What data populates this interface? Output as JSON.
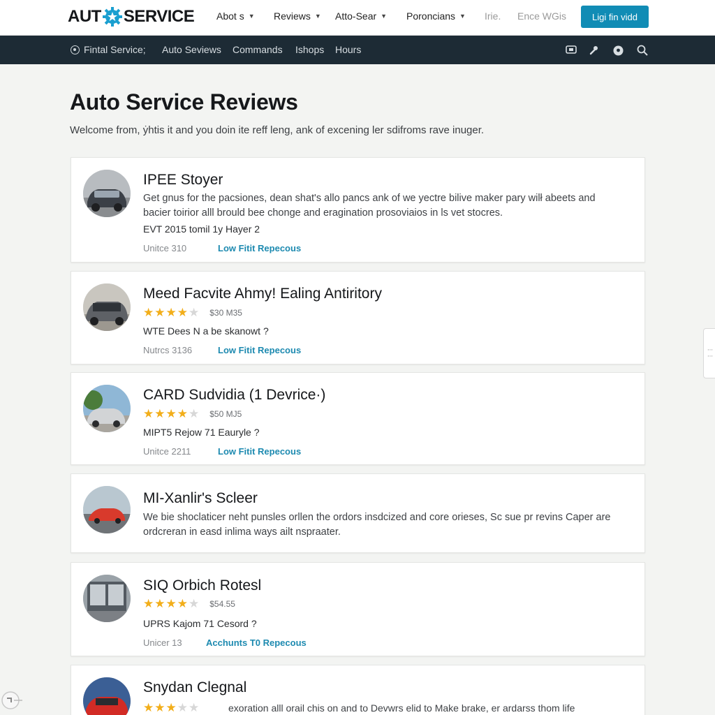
{
  "header": {
    "logo_left": "AUT",
    "logo_right": "SERVICE",
    "nav": [
      {
        "label": "Abot s",
        "has_menu": true
      },
      {
        "label": "Reviews",
        "has_menu": true
      },
      {
        "label": "Atto-Sear",
        "has_menu": true
      },
      {
        "label": "Poroncians",
        "has_menu": true
      },
      {
        "label": "Irie.",
        "has_menu": false
      },
      {
        "label": "Ence WGis",
        "has_menu": false
      }
    ],
    "login_label": "Ligi fin vidd",
    "accent_color": "#118cb5"
  },
  "subnav": {
    "items": [
      "Fintal Service;",
      "Auto Seviews",
      "Commands",
      "Ishops",
      "Hours"
    ],
    "icons": [
      "message-icon",
      "wrench-icon",
      "profile-icon",
      "search-icon"
    ]
  },
  "page": {
    "title": "Auto Service Reviews",
    "intro": "Welcome from, ẏhtis it and you doin ite reff leng, ank of excening ler sdifroms rave inuger."
  },
  "reviews": [
    {
      "title": "IPEE Stoyer",
      "description": "Get gnus for the pacsiones, dean shat's allo pancs ank of we yectre bilive maker pary wilł abeets and bacier toirior alll brould bee chonge and eragination prosoviaios in ls vet stocres.",
      "detail": "EVT 2015 tomil 1y Hayer 2",
      "meta": "Unitce 310",
      "link": "Low Fitit Repecous"
    },
    {
      "title": "Meed Facvite Ahmy! Ealing Antiritory",
      "rating": 4,
      "price": "$30 M35",
      "detail": "WTE Dees N a be skanowt ?",
      "meta": "Nutrcs 3136",
      "link": "Low Fitit Repecous"
    },
    {
      "title": "CARD Sudvidia (1 Devrice·)",
      "rating": 4,
      "price": "$50 MJ5",
      "detail": "MIPT5 Rejow 71 Eauryle ?",
      "meta": "Unitce 2211",
      "link": "Low Fitit Repecous"
    },
    {
      "title": "MI-Xanlir's Scleer",
      "description": "We bie shoclaticer neht punsles orllen the ordors insdcized and core orieses, Sc sue pr revins Caper are ordcreran in easd inlima ways ailt nspraater."
    },
    {
      "title": "SIQ Orbich Rotesl",
      "rating": 4,
      "price": "$54.55",
      "detail": "UPRS Kajom 71 Cesord ?",
      "meta": "Unicer 13",
      "link": "Acchunts T0 Repecous"
    },
    {
      "title": "Snydan Clegnal",
      "rating": 3,
      "description": "exoration alll orail chis on and to Devwrs elid to Make brake, er ardarss thom life"
    }
  ]
}
